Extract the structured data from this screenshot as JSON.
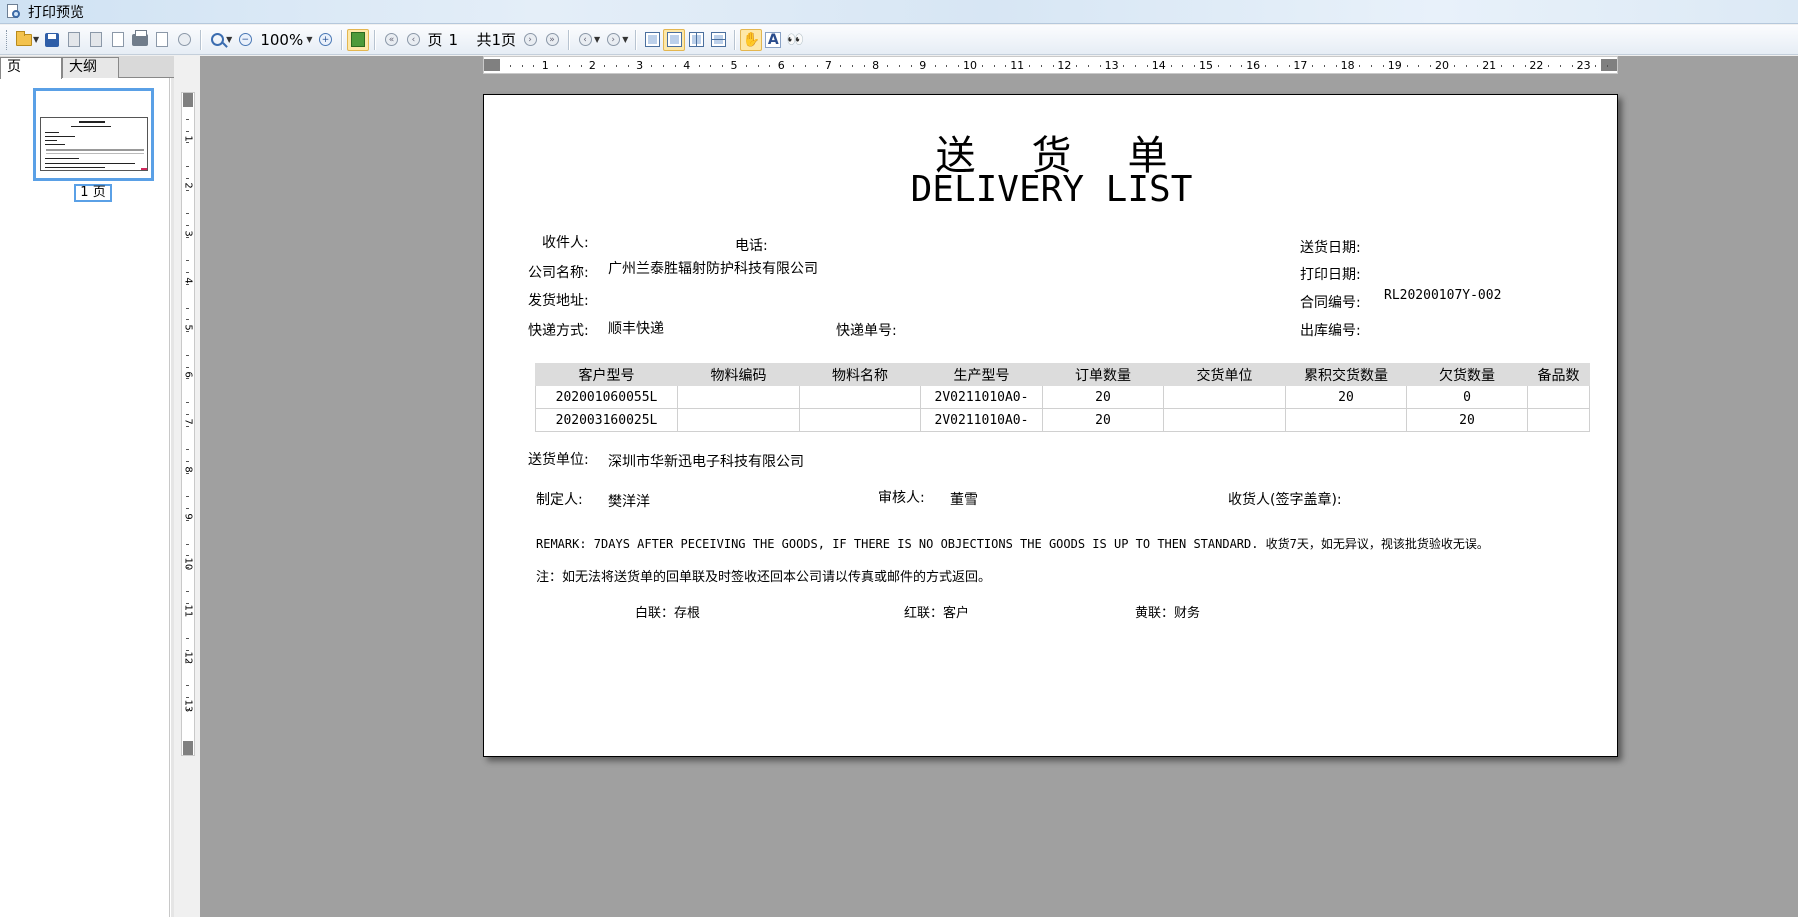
{
  "window": {
    "title": "打印预览"
  },
  "toolbar": {
    "zoom": "100%",
    "page_label": "页",
    "page_number": "1",
    "total_pages": "共1页"
  },
  "left_panel": {
    "tabs": [
      {
        "label": "页"
      },
      {
        "label": "大纲"
      }
    ],
    "thumbnail_label": "1 页"
  },
  "ruler": {
    "h_marks": [
      "1",
      "2",
      "3",
      "4",
      "5",
      "6",
      "7",
      "8",
      "9",
      "10",
      "11",
      "12",
      "13",
      "14",
      "15",
      "16",
      "17",
      "18",
      "19",
      "20",
      "21",
      "22",
      "23",
      "2"
    ],
    "v_marks": [
      "1",
      "2",
      "3",
      "4",
      "5",
      "6",
      "7",
      "8",
      "9",
      "10",
      "11",
      "12",
      "13"
    ]
  },
  "document": {
    "title_cn": "送货单",
    "title_en": "DELIVERY LIST",
    "fields": {
      "recipient_label": "收件人:",
      "phone_label": "电话:",
      "delivery_date_label": "送货日期:",
      "company_label": "公司名称:",
      "company_value": "广州兰泰胜辐射防护科技有限公司",
      "print_date_label": "打印日期:",
      "ship_address_label": "发货地址:",
      "contract_no_label": "合同编号:",
      "contract_no_value": "RL20200107Y-002",
      "express_method_label": "快递方式:",
      "express_method_value": "顺丰快递",
      "tracking_no_label": "快递单号:",
      "outbound_no_label": "出库编号:"
    },
    "table": {
      "headers": [
        "客户型号",
        "物料编码",
        "物料名称",
        "生产型号",
        "订单数量",
        "交货单位",
        "累积交货数量",
        "欠货数量",
        "备品数"
      ],
      "rows": [
        [
          "202001060055L",
          "",
          "",
          "2V0211010A0-",
          "20",
          "",
          "20",
          "0",
          ""
        ],
        [
          "202003160025L",
          "",
          "",
          "2V0211010A0-",
          "20",
          "",
          "",
          "20",
          ""
        ]
      ]
    },
    "shipper_label": "送货单位:",
    "shipper_value": "深圳市华新迅电子科技有限公司",
    "maker_label": "制定人:",
    "maker_value": "樊洋洋",
    "reviewer_label": "审核人:",
    "reviewer_value": "董雪",
    "consignee_label": "收货人(签字盖章):",
    "remark": "REMARK: 7DAYS AFTER PECEIVING THE GOODS, IF THERE IS NO OBJECTIONS THE GOODS IS UP TO THEN STANDARD. 收货7天，如无异议，视该批货验收无误。",
    "note": "注：如无法将送货单的回单联及时签收还回本公司请以传真或邮件的方式返回。",
    "copies": [
      "白联：存根",
      "红联：客户",
      "黄联：财务"
    ]
  }
}
